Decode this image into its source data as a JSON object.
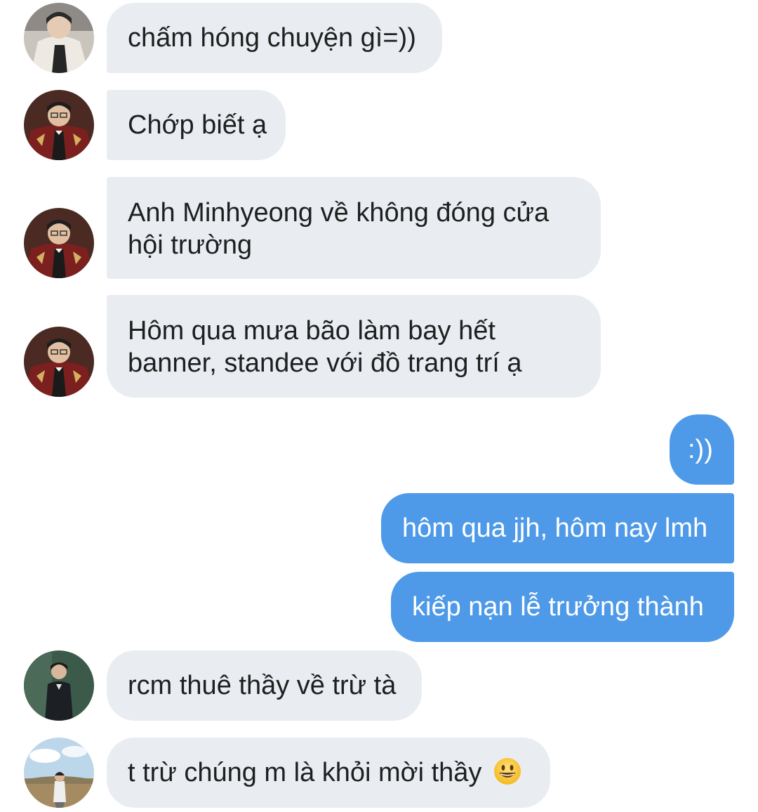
{
  "messages": [
    {
      "side": "in",
      "sender": "avatar-1",
      "text": "chấm hóng chuyện gì=))"
    },
    {
      "side": "in",
      "sender": "avatar-2",
      "text": "Chớp biết ạ"
    },
    {
      "side": "in",
      "sender": "avatar-2",
      "lines": [
        "Anh Minhyeong về không đóng cửa",
        "hội trường"
      ]
    },
    {
      "side": "in",
      "sender": "avatar-2",
      "lines": [
        "Hôm qua mưa bão làm bay hết",
        "banner, standee với đồ trang trí ạ"
      ]
    },
    {
      "side": "out",
      "text": ":))"
    },
    {
      "side": "out",
      "text": "hôm qua jjh, hôm nay lmh"
    },
    {
      "side": "out",
      "text": "kiếp nạn lễ trưởng thành"
    },
    {
      "side": "in",
      "sender": "avatar-3",
      "text": "rcm thuê thầy về trừ tà"
    },
    {
      "side": "in",
      "sender": "avatar-4",
      "text": "t trừ chúng m là khỏi mời thầy",
      "emoji": "grinning-face-emoji"
    }
  ],
  "colors": {
    "incoming_bubble": "#e9edf2",
    "outgoing_bubble": "#4e9ae8",
    "incoming_text": "#1f1f1f",
    "outgoing_text": "#ffffff"
  }
}
